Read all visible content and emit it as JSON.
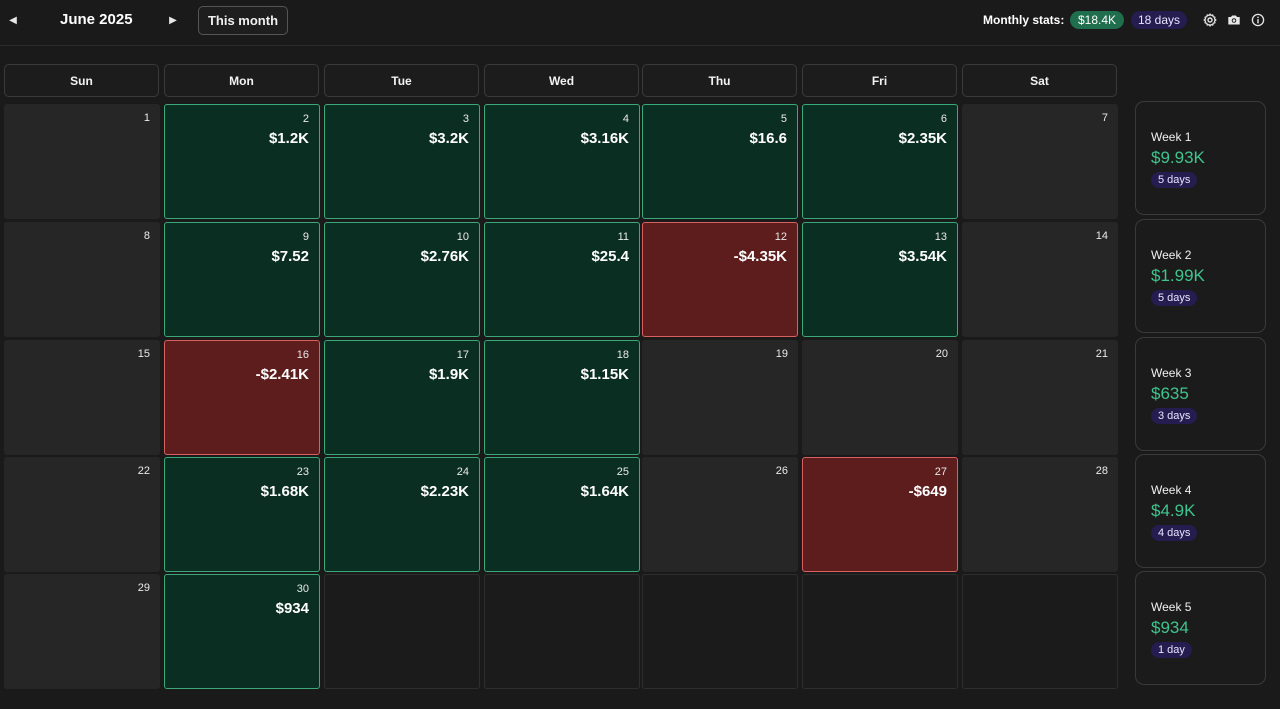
{
  "header": {
    "month_title": "June 2025",
    "this_month_label": "This month",
    "stats_label": "Monthly stats:",
    "stats_total": "$18.4K",
    "stats_days": "18 days",
    "icons": [
      "settings-icon",
      "camera-icon",
      "info-icon"
    ]
  },
  "colors": {
    "background": "#1a1a1a",
    "profit_cell": "#0b2e22",
    "profit_border": "#3aa878",
    "loss_cell": "#5d1d1d",
    "loss_border": "#d76060",
    "accent_green": "#3fc48d",
    "badge_purple": "#251c50"
  },
  "weekdays": [
    "Sun",
    "Mon",
    "Tue",
    "Wed",
    "Thu",
    "Fri",
    "Sat"
  ],
  "weeks": [
    {
      "days": [
        {
          "day": "1",
          "amount": "",
          "status": "empty"
        },
        {
          "day": "2",
          "amount": "$1.2K",
          "status": "pos"
        },
        {
          "day": "3",
          "amount": "$3.2K",
          "status": "pos"
        },
        {
          "day": "4",
          "amount": "$3.16K",
          "status": "pos"
        },
        {
          "day": "5",
          "amount": "$16.6",
          "status": "pos"
        },
        {
          "day": "6",
          "amount": "$2.35K",
          "status": "pos"
        },
        {
          "day": "7",
          "amount": "",
          "status": "empty"
        }
      ],
      "summary": {
        "label": "Week 1",
        "amount": "$9.93K",
        "days": "5 days"
      }
    },
    {
      "days": [
        {
          "day": "8",
          "amount": "",
          "status": "empty"
        },
        {
          "day": "9",
          "amount": "$7.52",
          "status": "pos"
        },
        {
          "day": "10",
          "amount": "$2.76K",
          "status": "pos"
        },
        {
          "day": "11",
          "amount": "$25.4",
          "status": "pos"
        },
        {
          "day": "12",
          "amount": "-$4.35K",
          "status": "neg"
        },
        {
          "day": "13",
          "amount": "$3.54K",
          "status": "pos"
        },
        {
          "day": "14",
          "amount": "",
          "status": "empty"
        }
      ],
      "summary": {
        "label": "Week 2",
        "amount": "$1.99K",
        "days": "5 days"
      }
    },
    {
      "days": [
        {
          "day": "15",
          "amount": "",
          "status": "empty"
        },
        {
          "day": "16",
          "amount": "-$2.41K",
          "status": "neg"
        },
        {
          "day": "17",
          "amount": "$1.9K",
          "status": "pos"
        },
        {
          "day": "18",
          "amount": "$1.15K",
          "status": "pos"
        },
        {
          "day": "19",
          "amount": "",
          "status": "empty"
        },
        {
          "day": "20",
          "amount": "",
          "status": "empty"
        },
        {
          "day": "21",
          "amount": "",
          "status": "empty"
        }
      ],
      "summary": {
        "label": "Week 3",
        "amount": "$635",
        "days": "3 days"
      }
    },
    {
      "days": [
        {
          "day": "22",
          "amount": "",
          "status": "empty"
        },
        {
          "day": "23",
          "amount": "$1.68K",
          "status": "pos"
        },
        {
          "day": "24",
          "amount": "$2.23K",
          "status": "pos"
        },
        {
          "day": "25",
          "amount": "$1.64K",
          "status": "pos"
        },
        {
          "day": "26",
          "amount": "",
          "status": "empty"
        },
        {
          "day": "27",
          "amount": "-$649",
          "status": "neg"
        },
        {
          "day": "28",
          "amount": "",
          "status": "empty"
        }
      ],
      "summary": {
        "label": "Week 4",
        "amount": "$4.9K",
        "days": "4 days"
      }
    },
    {
      "days": [
        {
          "day": "29",
          "amount": "",
          "status": "empty"
        },
        {
          "day": "30",
          "amount": "$934",
          "status": "pos"
        },
        {
          "day": "",
          "amount": "",
          "status": "blank"
        },
        {
          "day": "",
          "amount": "",
          "status": "blank"
        },
        {
          "day": "",
          "amount": "",
          "status": "blank"
        },
        {
          "day": "",
          "amount": "",
          "status": "blank"
        },
        {
          "day": "",
          "amount": "",
          "status": "blank"
        }
      ],
      "summary": {
        "label": "Week 5",
        "amount": "$934",
        "days": "1 day"
      }
    }
  ]
}
